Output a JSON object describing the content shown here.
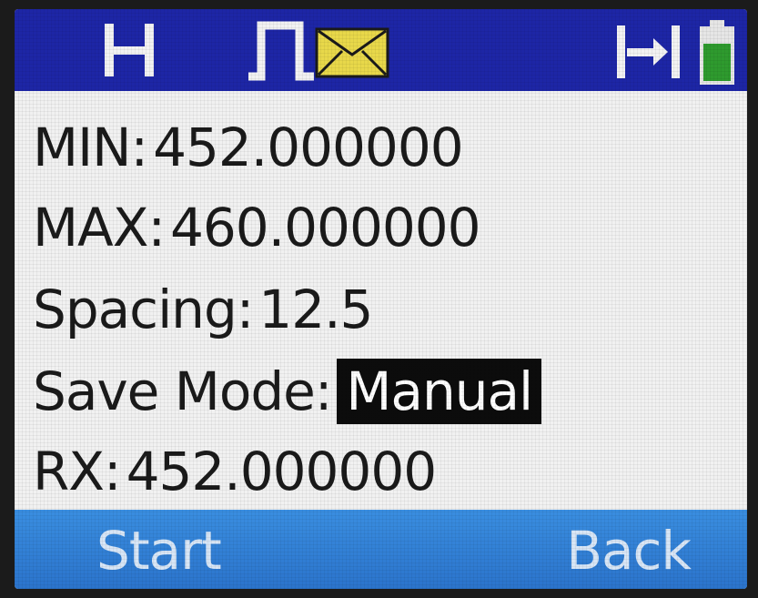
{
  "status_bar": {
    "icons": [
      "h-mode-icon",
      "pulse-waveform-icon",
      "message-envelope-icon",
      "skip-to-end-icon",
      "battery-icon"
    ],
    "colors": {
      "background": "#1d26a6",
      "envelope": "#e8d84a",
      "battery_fill": "#2e9a2e"
    }
  },
  "fields": [
    {
      "label": "MIN:",
      "value": "452.000000"
    },
    {
      "label": "MAX:",
      "value": "460.000000"
    },
    {
      "label": "Spacing:",
      "value": "12.5"
    },
    {
      "label": "Save Mode:",
      "value": "Manual",
      "selected": true
    },
    {
      "label": "RX:",
      "value": "452.000000"
    }
  ],
  "softkeys": {
    "left_label": "Start",
    "right_label": "Back",
    "color": "#2b74cc"
  }
}
